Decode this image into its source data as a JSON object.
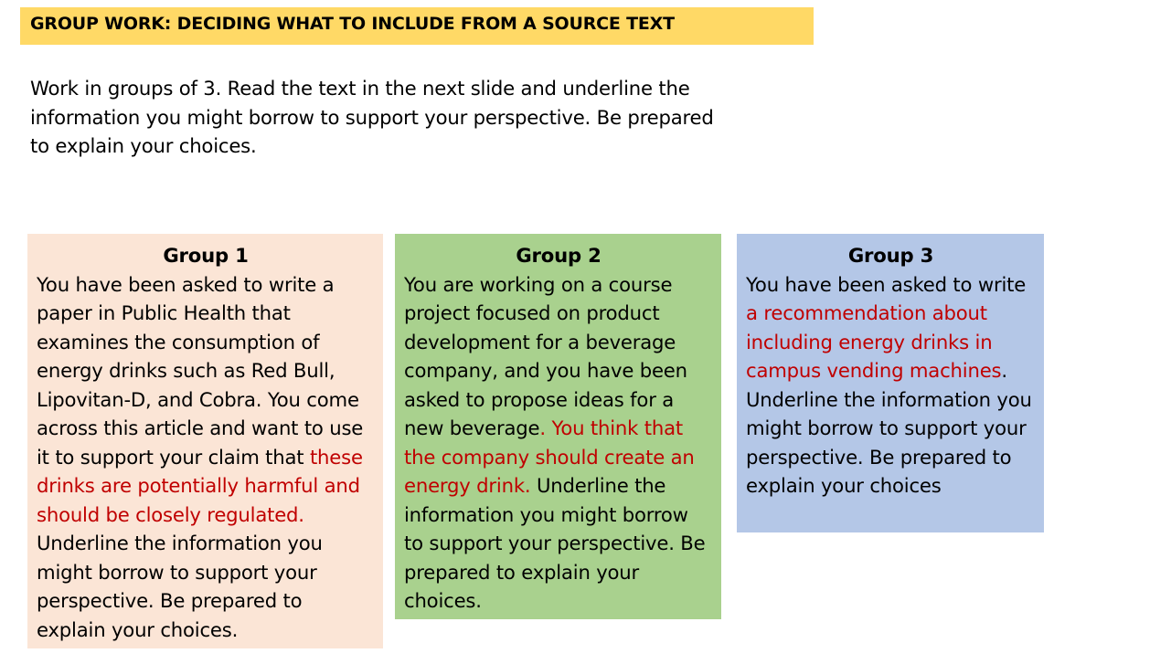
{
  "slide": {
    "title": "GROUP WORK: DECIDING WHAT TO INCLUDE FROM A SOURCE TEXT",
    "intro": "Work in groups of 3. Read the text in the next slide and underline the information you might borrow to support your perspective. Be prepared to explain your choices."
  },
  "groups": [
    {
      "heading": "Group 1",
      "text_before": "You have been asked to write a paper in Public Health that examines the consumption of energy drinks such as Red Bull, Lipovitan-D, and Cobra. You come across this article and want to use it to support your claim that ",
      "highlight": "these drinks are potentially harmful and should be closely regulated.",
      "text_after": " Underline the information you might borrow to support your perspective. Be prepared to explain your choices."
    },
    {
      "heading": "Group 2",
      "text_before": "You are working on a course project focused on product development for a beverage company, and you have been asked to propose ideas for a new beverage",
      "highlight": ". You think that the company should create an energy drink.",
      "text_after": " Underline the information you might borrow to support your perspective. Be prepared to explain your choices."
    },
    {
      "heading": "Group 3",
      "text_before": "You have been asked to write ",
      "highlight": "a recommendation about including energy drinks in campus vending machines",
      "text_after": ". Underline the information you might borrow to support your perspective. Be prepared to explain your choices"
    }
  ],
  "colors": {
    "title_bar": "#ffd966",
    "group_1_bg": "#fbe5d6",
    "group_2_bg": "#a9d18e",
    "group_3_bg": "#b4c7e7",
    "highlight_text": "#c00000"
  }
}
